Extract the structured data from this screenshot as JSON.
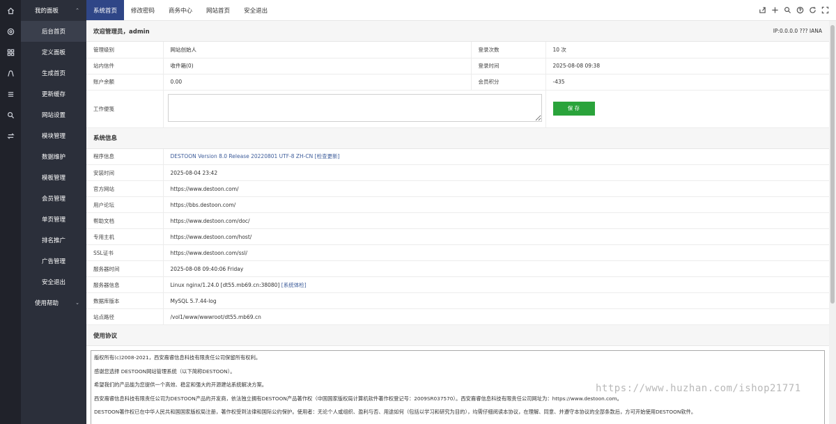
{
  "sidebar": {
    "header": "我的面板",
    "items": [
      {
        "label": "后台首页",
        "active": true
      },
      {
        "label": "定义面板"
      },
      {
        "label": "生成首页"
      },
      {
        "label": "更新缓存"
      },
      {
        "label": "网站设置"
      },
      {
        "label": "模块管理"
      },
      {
        "label": "数据维护"
      },
      {
        "label": "模板管理"
      },
      {
        "label": "会员管理"
      },
      {
        "label": "单页管理"
      },
      {
        "label": "排名推广"
      },
      {
        "label": "广告管理"
      },
      {
        "label": "安全退出"
      }
    ],
    "help": "使用帮助"
  },
  "rail_icons": [
    "home-icon",
    "gear-icon",
    "grid-icon",
    "user-icon",
    "list-icon",
    "search-icon",
    "swap-icon"
  ],
  "tabs": [
    "系统首页",
    "修改密码",
    "商务中心",
    "网站首页",
    "安全退出"
  ],
  "toolbar_icons": [
    "share-icon",
    "plus-icon",
    "search-icon",
    "help-icon",
    "refresh-icon",
    "fullscreen-icon"
  ],
  "welcome": {
    "title": "欢迎管理员，admin",
    "ip": "IP:0.0.0.0 ??? IANA"
  },
  "account": {
    "rows": [
      {
        "l1": "管理级别",
        "v1": "网站创始人",
        "l2": "登录次数",
        "v2": "10 次"
      },
      {
        "l1": "站内信件",
        "v1": "收件箱(0)",
        "l2": "登录时间",
        "v2": "2025-08-08 09:38"
      },
      {
        "l1": "账户余额",
        "v1": "0.00",
        "l2": "会员积分",
        "v2": "-435"
      }
    ],
    "memo_label": "工作便笺",
    "memo_value": "",
    "save_label": "保 存"
  },
  "sysinfo": {
    "title": "系统信息",
    "rows": [
      {
        "label": "程序信息",
        "value": "DESTOON Version 8.0 Release 20220801 UTF-8 ZH-CN",
        "link": "[检查更新]"
      },
      {
        "label": "安装时间",
        "value": "2025-08-04 23:42"
      },
      {
        "label": "官方网站",
        "value": "https://www.destoon.com/"
      },
      {
        "label": "用户论坛",
        "value": "https://bbs.destoon.com/"
      },
      {
        "label": "帮助文档",
        "value": "https://www.destoon.com/doc/"
      },
      {
        "label": "专用主机",
        "value": "https://www.destoon.com/host/"
      },
      {
        "label": "SSL证书",
        "value": "https://www.destoon.com/ssl/"
      },
      {
        "label": "服务器时间",
        "value": "2025-08-08 09:40:06 Friday"
      },
      {
        "label": "服务器信息",
        "value": "Linux nginx/1.24.0 [dt55.mb69.cn:38080]",
        "link": "[系统体检]"
      },
      {
        "label": "数据库版本",
        "value": "MySQL 5.7.44-log"
      },
      {
        "label": "站点路径",
        "value": "/vol1/www/wwwroot/dt55.mb69.cn"
      }
    ]
  },
  "license": {
    "title": "使用协议",
    "paragraphs": [
      "版权所有(c)2008-2021，西安裔睿信息科技有限责任公司保留所有权利。",
      "感谢您选择 DESTOON网站管理系统（以下简称DESTOON）。",
      "希望我们的产品能为您提供一个高效、稳定和强大的开源建站系统解决方案。",
      "西安裔睿信息科技有限责任公司为DESTOON产品的开发商，依法独立拥有DESTOON产品著作权（中国国家版权局计算机软件著作权登记号：2009SR037570）。西安裔睿信息科技有限责任公司网址为：https://www.destoon.com。",
      "DESTOON著作权已在中华人民共和国国家版权局注册，著作权受到法律和国际公约保护。使用者：无论个人或组织、盈利与否、用途如何（包括以学习和研究为目的），均需仔细阅读本协议，在理解、同意、并遵守本协议的全部条款后，方可开始使用DESTOON软件。"
    ]
  },
  "watermark": "https://www.huzhan.com/ishop21771",
  "colors": {
    "accent": "#2f4687",
    "sidebar": "#2b2f3a",
    "rail": "#20222a",
    "save": "#2aa33b",
    "link": "#3d5c9a"
  }
}
